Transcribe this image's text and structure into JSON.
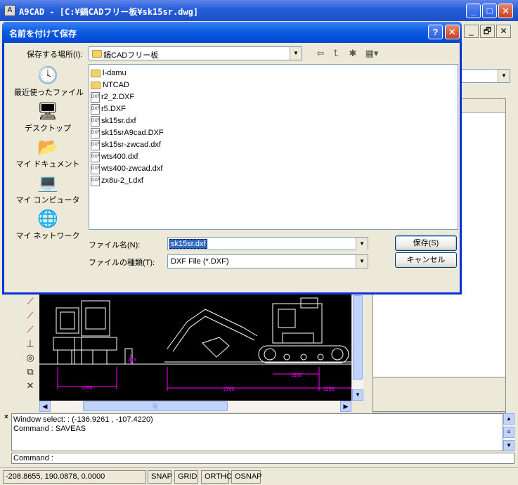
{
  "main": {
    "title": "A9CAD - [C:¥鍋CADフリー板¥sk15sr.dwg]"
  },
  "dialog": {
    "title": "名前を付けて保存",
    "save_in_label": "保存する場所(I):",
    "save_in_value": "鍋CADフリー板",
    "places": [
      {
        "label": "最近使ったファイル",
        "icon": "recent-documents-icon"
      },
      {
        "label": "デスクトップ",
        "icon": "desktop-icon"
      },
      {
        "label": "マイ ドキュメント",
        "icon": "my-documents-icon"
      },
      {
        "label": "マイ コンピュータ",
        "icon": "my-computer-icon"
      },
      {
        "label": "マイ ネットワーク",
        "icon": "my-network-icon"
      }
    ],
    "files": [
      {
        "name": "l-damu",
        "type": "folder"
      },
      {
        "name": "NTCAD",
        "type": "folder"
      },
      {
        "name": "r2_2.DXF",
        "type": "dxf"
      },
      {
        "name": "r5.DXF",
        "type": "dxf"
      },
      {
        "name": "sk15sr.dxf",
        "type": "dxf"
      },
      {
        "name": "sk15srA9cad.DXF",
        "type": "dxf"
      },
      {
        "name": "sk15sr-zwcad.dxf",
        "type": "dxf"
      },
      {
        "name": "wts400.dxf",
        "type": "dxf"
      },
      {
        "name": "wts400-zwcad.dxf",
        "type": "dxf"
      },
      {
        "name": "zx8u-2_t.dxf",
        "type": "dxf"
      }
    ],
    "filename_label": "ファイル名(N):",
    "filename_value": "sk15sr.dxf",
    "filetype_label": "ファイルの種類(T):",
    "filetype_value": "DXF File (*.DXF)",
    "save_button": "保存(S)",
    "cancel_button": "キャンセル"
  },
  "drawing": {
    "dims": [
      "1350",
      "215",
      "2790",
      "1600",
      "1250"
    ]
  },
  "command": {
    "history": [
      "Window select: : (-136.9261 , -107.4220)",
      "Command : SAVEAS"
    ],
    "prompt": "Command :"
  },
  "status": {
    "coords": "-208.8655, 190.0878, 0.0000",
    "buttons": [
      "SNAP",
      "GRID",
      "ORTHO",
      "OSNAP"
    ]
  },
  "colors": {
    "titlebar": "#0a5bde",
    "canvas_bg": "#000000",
    "dimension": "#ff00ff",
    "selection": "#316ac5"
  }
}
